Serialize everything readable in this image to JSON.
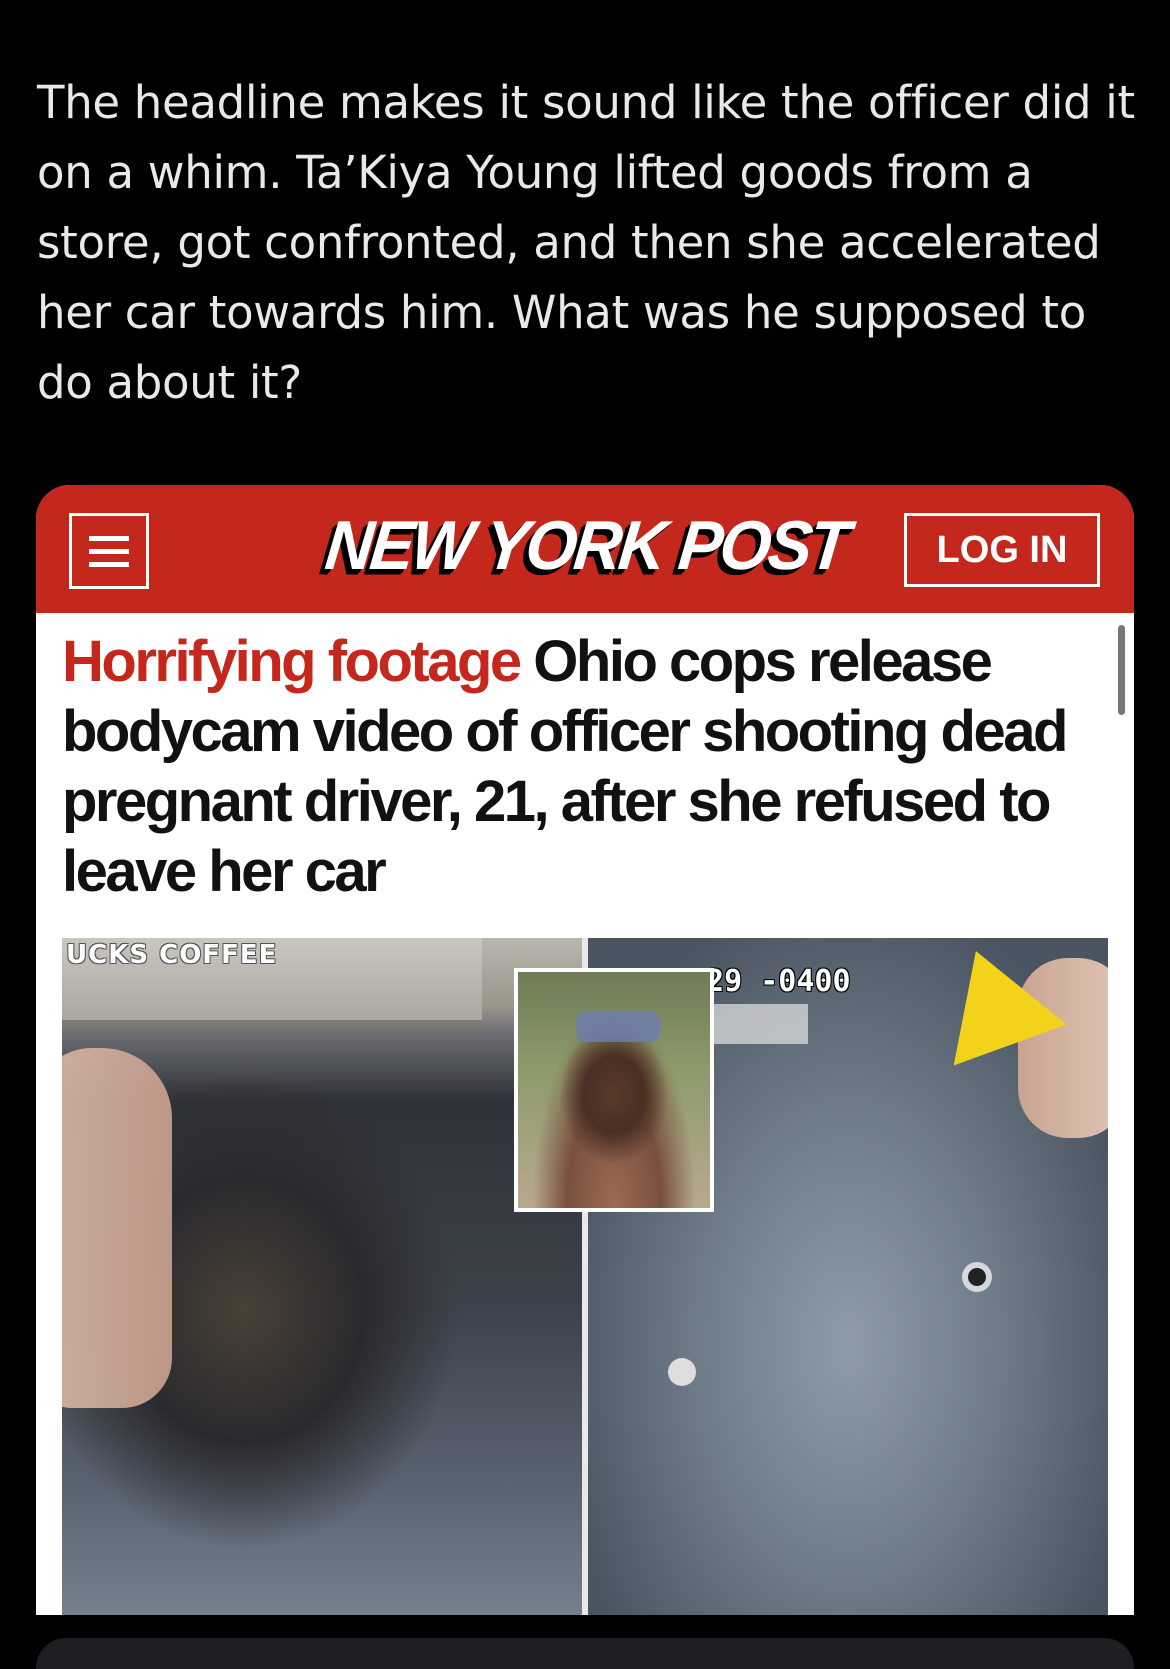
{
  "tweet": {
    "text": "The headline makes it sound like the officer did it on a whim. Ta’Kiya Young lifted goods from a store, got confronted, and then she accelerated her car towards him. What was he supposed to do about it?"
  },
  "card": {
    "site_name": "NEW YORK POST",
    "login_label": "LOG IN",
    "headline_kicker": "Horrifying footage",
    "headline_text": " Ohio cops release bodycam video of officer shooting dead pregnant driver, 21, after she refused to leave her car",
    "image": {
      "store_sign": "UCKS COFFEE",
      "bodycam_timestamp": ":29 -0400"
    }
  },
  "colors": {
    "brand_red": "#c4281c",
    "background": "#000000",
    "tweet_text": "#e7e9ea"
  }
}
